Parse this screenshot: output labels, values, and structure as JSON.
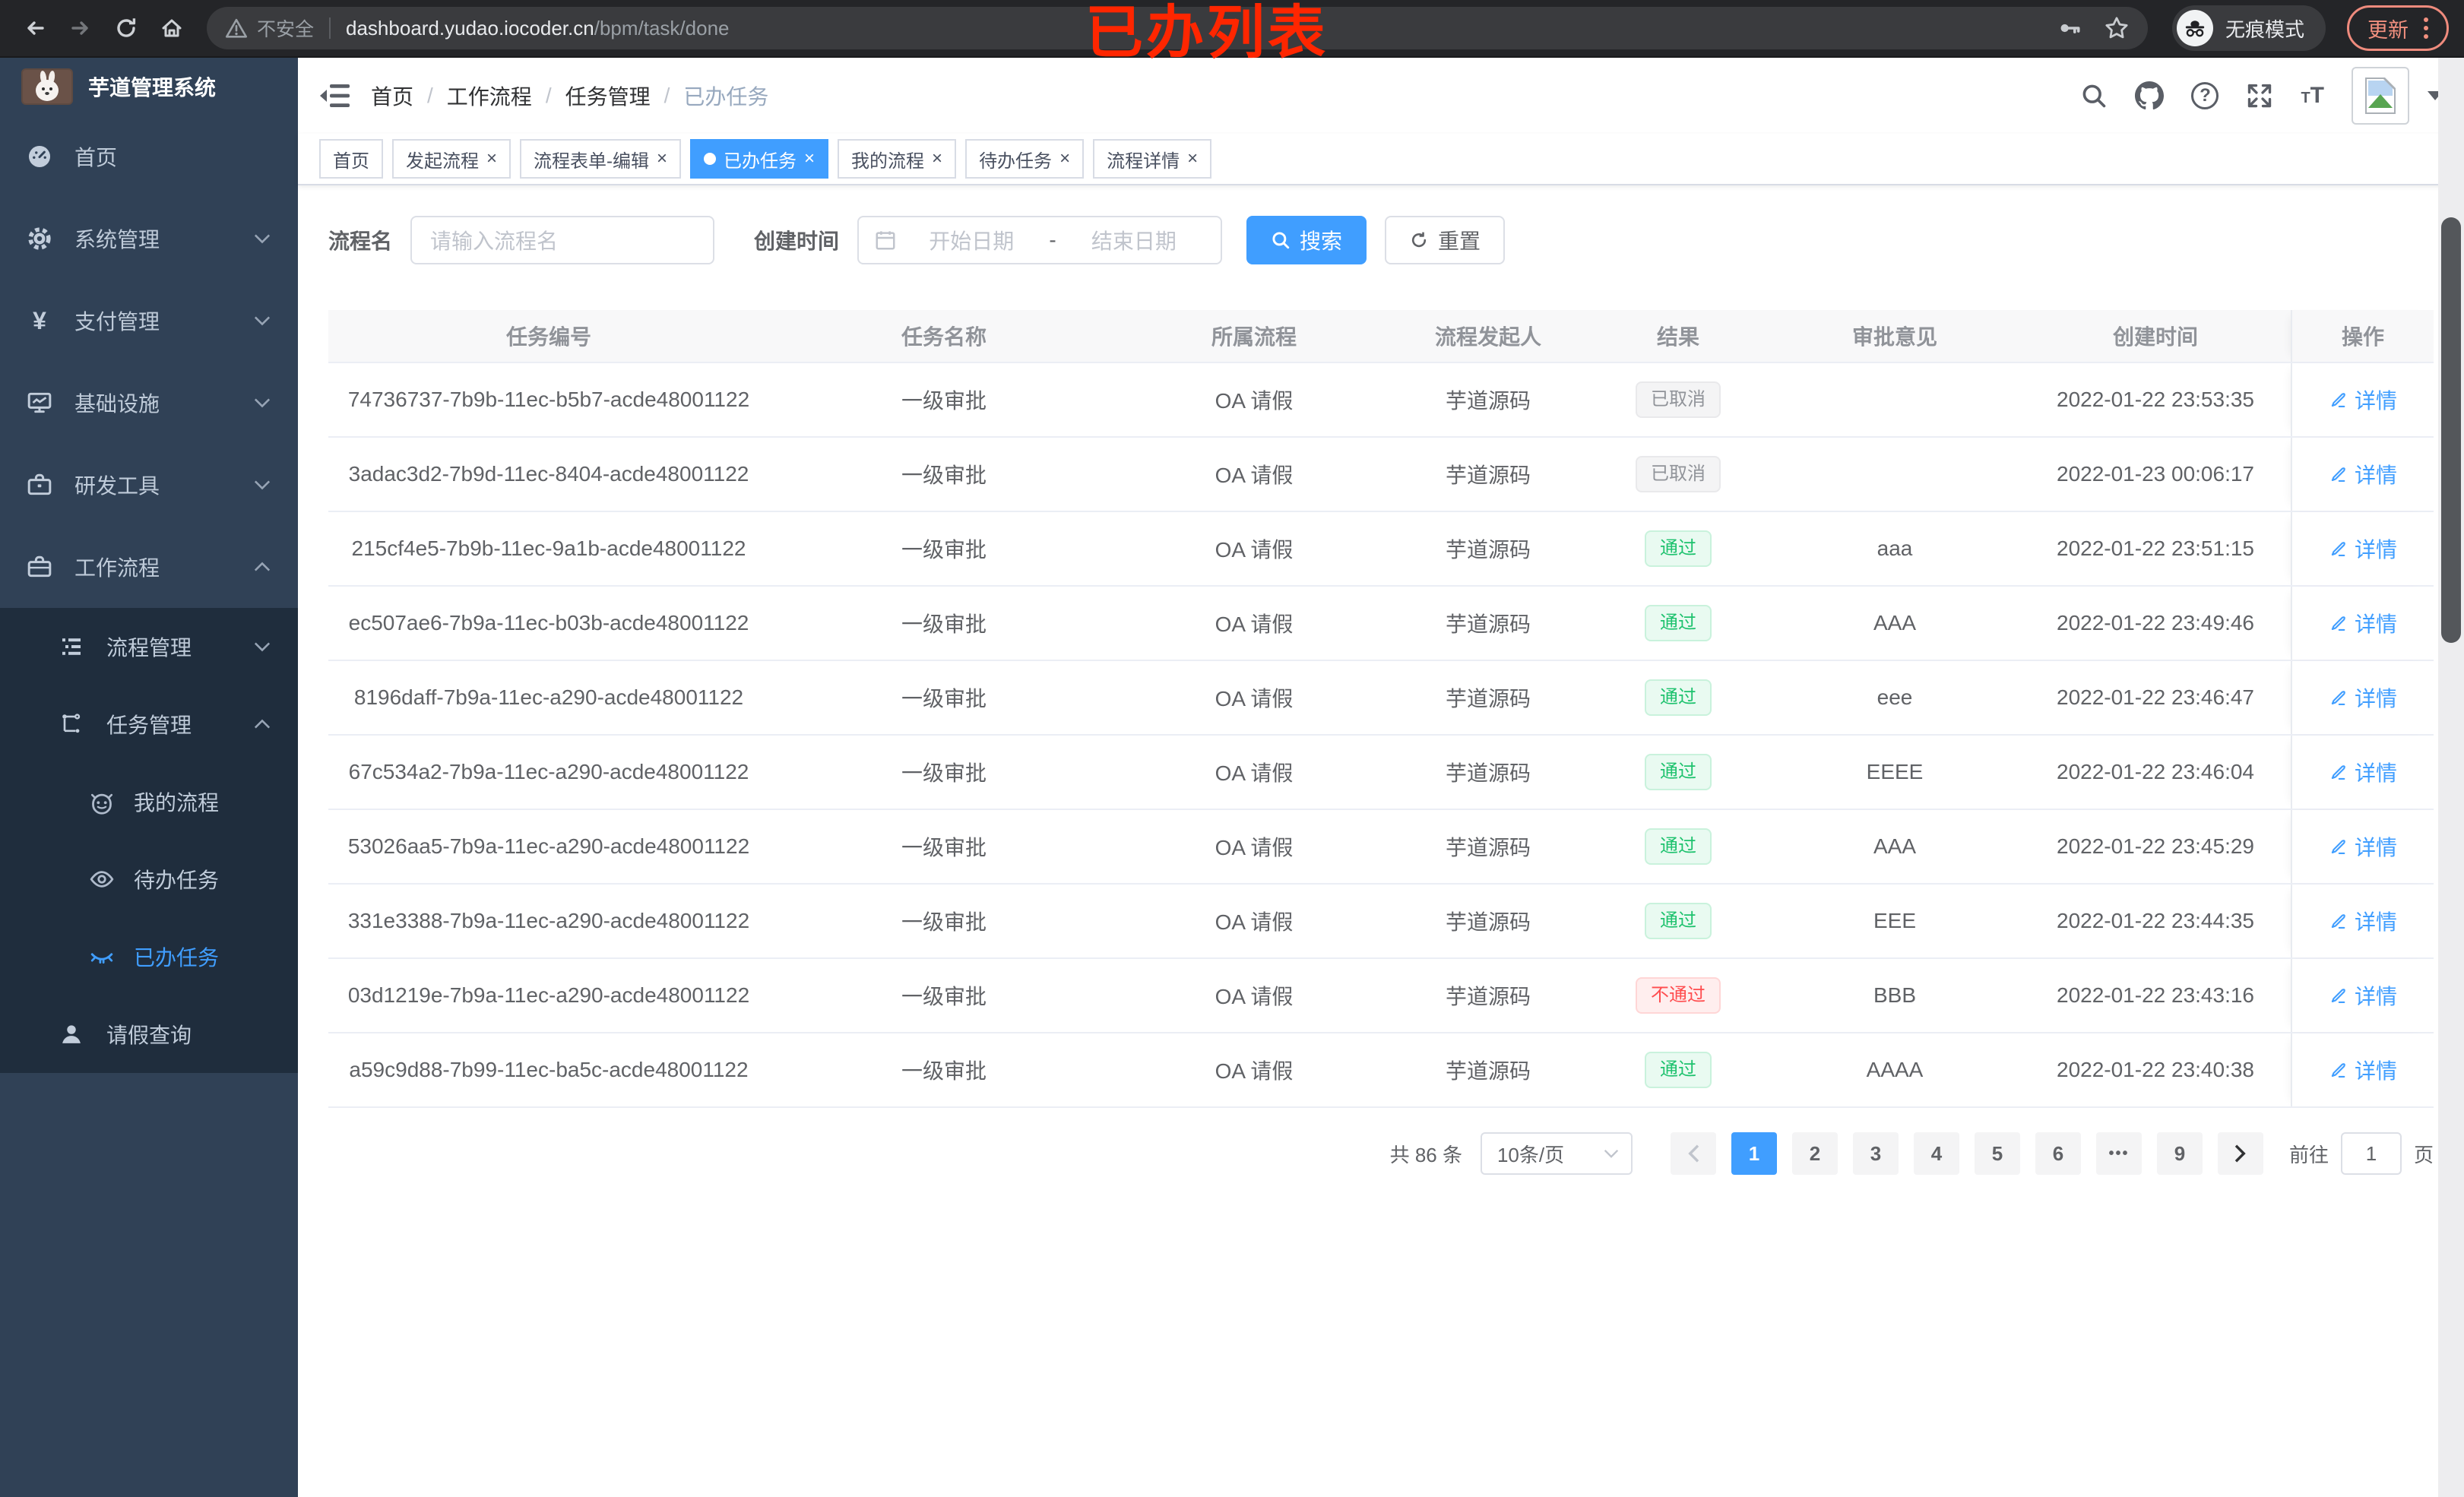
{
  "browser": {
    "security_label": "不安全",
    "url_host": "dashboard.yudao.iocoder.cn",
    "url_path": "/bpm/task/done",
    "incognito_label": "无痕模式",
    "update_label": "更新"
  },
  "annotation": "已办列表",
  "sidebar": {
    "title": "芋道管理系统",
    "items": [
      {
        "label": "首页"
      },
      {
        "label": "系统管理"
      },
      {
        "label": "支付管理"
      },
      {
        "label": "基础设施"
      },
      {
        "label": "研发工具"
      },
      {
        "label": "工作流程"
      }
    ],
    "submenu": [
      {
        "label": "流程管理"
      },
      {
        "label": "任务管理"
      },
      {
        "label": "我的流程"
      },
      {
        "label": "待办任务"
      },
      {
        "label": "已办任务"
      },
      {
        "label": "请假查询"
      }
    ]
  },
  "header": {
    "breadcrumb": [
      {
        "label": "首页"
      },
      {
        "label": "工作流程"
      },
      {
        "label": "任务管理"
      },
      {
        "label": "已办任务"
      }
    ]
  },
  "tabs": [
    {
      "label": "首页"
    },
    {
      "label": "发起流程"
    },
    {
      "label": "流程表单-编辑"
    },
    {
      "label": "已办任务"
    },
    {
      "label": "我的流程"
    },
    {
      "label": "待办任务"
    },
    {
      "label": "流程详情"
    }
  ],
  "filters": {
    "name_label": "流程名",
    "name_placeholder": "请输入流程名",
    "time_label": "创建时间",
    "start_placeholder": "开始日期",
    "range_separator": "-",
    "end_placeholder": "结束日期",
    "search_label": "搜索",
    "reset_label": "重置"
  },
  "table": {
    "headers": [
      "任务编号",
      "任务名称",
      "所属流程",
      "流程发起人",
      "结果",
      "审批意见",
      "创建时间",
      "操作"
    ],
    "action_label": "详情",
    "rows": [
      {
        "id": "74736737-7b9b-11ec-b5b7-acde48001122",
        "name": "一级审批",
        "process": "OA 请假",
        "starter": "芋道源码",
        "result": "已取消",
        "result_type": "info",
        "opinion": "",
        "created": "2022-01-22 23:53:35"
      },
      {
        "id": "3adac3d2-7b9d-11ec-8404-acde48001122",
        "name": "一级审批",
        "process": "OA 请假",
        "starter": "芋道源码",
        "result": "已取消",
        "result_type": "info",
        "opinion": "",
        "created": "2022-01-23 00:06:17"
      },
      {
        "id": "215cf4e5-7b9b-11ec-9a1b-acde48001122",
        "name": "一级审批",
        "process": "OA 请假",
        "starter": "芋道源码",
        "result": "通过",
        "result_type": "success",
        "opinion": "aaa",
        "created": "2022-01-22 23:51:15"
      },
      {
        "id": "ec507ae6-7b9a-11ec-b03b-acde48001122",
        "name": "一级审批",
        "process": "OA 请假",
        "starter": "芋道源码",
        "result": "通过",
        "result_type": "success",
        "opinion": "AAA",
        "created": "2022-01-22 23:49:46"
      },
      {
        "id": "8196daff-7b9a-11ec-a290-acde48001122",
        "name": "一级审批",
        "process": "OA 请假",
        "starter": "芋道源码",
        "result": "通过",
        "result_type": "success",
        "opinion": "eee",
        "created": "2022-01-22 23:46:47"
      },
      {
        "id": "67c534a2-7b9a-11ec-a290-acde48001122",
        "name": "一级审批",
        "process": "OA 请假",
        "starter": "芋道源码",
        "result": "通过",
        "result_type": "success",
        "opinion": "EEEE",
        "created": "2022-01-22 23:46:04"
      },
      {
        "id": "53026aa5-7b9a-11ec-a290-acde48001122",
        "name": "一级审批",
        "process": "OA 请假",
        "starter": "芋道源码",
        "result": "通过",
        "result_type": "success",
        "opinion": "AAA",
        "created": "2022-01-22 23:45:29"
      },
      {
        "id": "331e3388-7b9a-11ec-a290-acde48001122",
        "name": "一级审批",
        "process": "OA 请假",
        "starter": "芋道源码",
        "result": "通过",
        "result_type": "success",
        "opinion": "EEE",
        "created": "2022-01-22 23:44:35"
      },
      {
        "id": "03d1219e-7b9a-11ec-a290-acde48001122",
        "name": "一级审批",
        "process": "OA 请假",
        "starter": "芋道源码",
        "result": "不通过",
        "result_type": "danger",
        "opinion": "BBB",
        "created": "2022-01-22 23:43:16"
      },
      {
        "id": "a59c9d88-7b99-11ec-ba5c-acde48001122",
        "name": "一级审批",
        "process": "OA 请假",
        "starter": "芋道源码",
        "result": "通过",
        "result_type": "success",
        "opinion": "AAAA",
        "created": "2022-01-22 23:40:38"
      }
    ]
  },
  "pagination": {
    "total": "共 86 条",
    "page_size": "10条/页",
    "pages": [
      "1",
      "2",
      "3",
      "4",
      "5",
      "6",
      "•••",
      "9"
    ],
    "active_page": "1",
    "goto_prefix": "前往",
    "goto_value": "1",
    "goto_suffix": "页"
  },
  "colors": {
    "accent": "#409eff",
    "success": "#1ec26e",
    "danger": "#ff4d4f",
    "sidebar_bg": "#304156",
    "submenu_bg": "#1f2d3d"
  }
}
